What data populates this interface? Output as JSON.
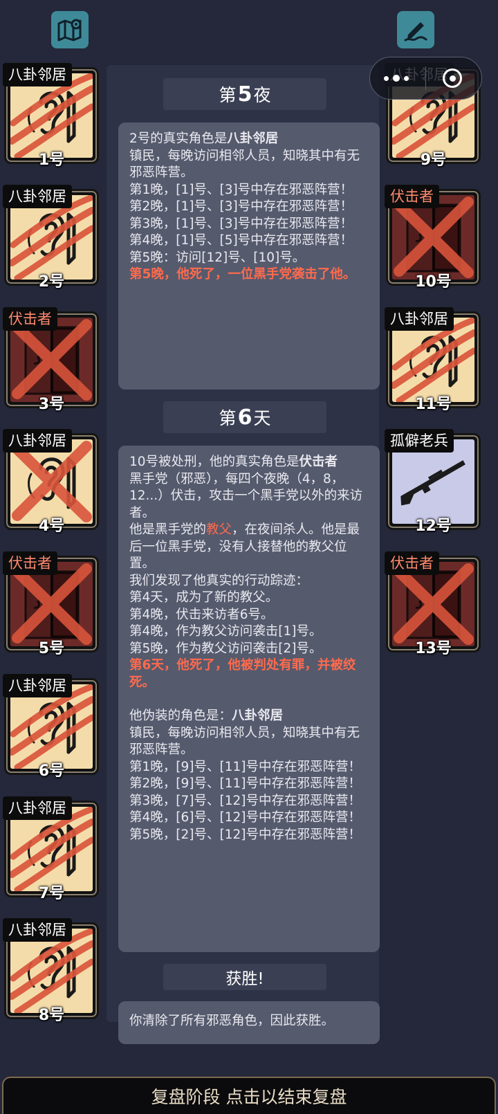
{
  "top": {
    "map_icon": "map-pin-icon",
    "note_icon": "pen-note-icon"
  },
  "cards": {
    "left": [
      {
        "role": "八卦邻居",
        "num": "1号",
        "art": "ear",
        "dead": "claw"
      },
      {
        "role": "八卦邻居",
        "num": "2号",
        "art": "ear",
        "dead": "claw"
      },
      {
        "role": "伏击者",
        "num": "3号",
        "art": "door",
        "dead": "x"
      },
      {
        "role": "八卦邻居",
        "num": "4号",
        "art": "ear",
        "dead": "x"
      },
      {
        "role": "伏击者",
        "num": "5号",
        "art": "door",
        "dead": "x"
      },
      {
        "role": "八卦邻居",
        "num": "6号",
        "art": "ear",
        "dead": "claw"
      },
      {
        "role": "八卦邻居",
        "num": "7号",
        "art": "ear",
        "dead": "claw"
      },
      {
        "role": "八卦邻居",
        "num": "8号",
        "art": "ear",
        "dead": "claw"
      }
    ],
    "right": [
      {
        "role": "八卦邻居",
        "num": "9号",
        "art": "ear",
        "dead": "claw"
      },
      {
        "role": "伏击者",
        "num": "10号",
        "art": "door",
        "dead": "x"
      },
      {
        "role": "八卦邻居",
        "num": "11号",
        "art": "ear",
        "dead": "claw"
      },
      {
        "role": "孤僻老兵",
        "num": "12号",
        "art": "rifle",
        "dead": "none"
      },
      {
        "role": "伏击者",
        "num": "13号",
        "art": "door",
        "dead": "x"
      }
    ]
  },
  "sections": {
    "night5": {
      "pre": "第",
      "big": "5",
      "post": "夜"
    },
    "day6": {
      "pre": "第",
      "big": "6",
      "post": "天"
    },
    "win": {
      "text": "获胜!"
    }
  },
  "msg1": {
    "l1a": "2号的真实角色是",
    "l1b": "八卦邻居",
    "l2": "镇民，每晚访问相邻人员，知晓其中有无邪恶阵营。",
    "l3": "第1晚，[1]号、[3]号中存在邪恶阵营！",
    "l4": "第2晚，[1]号、[3]号中存在邪恶阵营！",
    "l5": "第3晚，[1]号、[3]号中存在邪恶阵营！",
    "l6": "第4晚，[1]号、[5]号中存在邪恶阵营！",
    "l7": "第5晚：访问[12]号、[10]号。",
    "l8": "第5晚，他死了，一位黑手党袭击了他。"
  },
  "msg2": {
    "l1a": "10号被处刑，他的真实角色是",
    "l1b": "伏击者",
    "l2": "黑手党（邪恶），每四个夜晚（4，8，12...）伏击，攻击一个黑手党以外的来访者。",
    "l3a": "他是黑手党的",
    "l3b": "教父",
    "l3c": "，在夜间杀人。他是最后一位黑手党，没有人接替他的教父位置。",
    "l4": "我们发现了他真实的行动踪迹：",
    "l5": "第4天，成为了新的教父。",
    "l6": "第4晚，伏击来访者6号。",
    "l7": "第4晚，作为教父访问袭击[1]号。",
    "l8": "第5晚，作为教父访问袭击[2]号。",
    "l9": "第6天，他死了，他被判处有罪，并被绞死。",
    "l10a": "他伪装的角色是：",
    "l10b": "八卦邻居",
    "l11": "镇民，每晚访问相邻人员，知晓其中有无邪恶阵营。",
    "l12": "第1晚，[9]号、[11]号中存在邪恶阵营！",
    "l13": "第2晚，[9]号、[11]号中存在邪恶阵营！",
    "l14": "第3晚，[7]号、[12]号中存在邪恶阵营！",
    "l15": "第4晚，[6]号、[12]号中存在邪恶阵营！",
    "l16": "第5晚，[2]号、[12]号中存在邪恶阵营！"
  },
  "msg3": {
    "text": "你清除了所有邪恶角色，因此获胜。"
  },
  "bottom": {
    "text": "复盘阶段 点击以结束复盘"
  },
  "colors": {
    "neighbor_bg": "#f4dcaa",
    "ambusher_bg": "#6b2a28",
    "veteran_bg": "#c9cae8",
    "claw": "#d9553b",
    "evil_tag": "#ff8a6e",
    "highlight": "#ff6a4d"
  }
}
